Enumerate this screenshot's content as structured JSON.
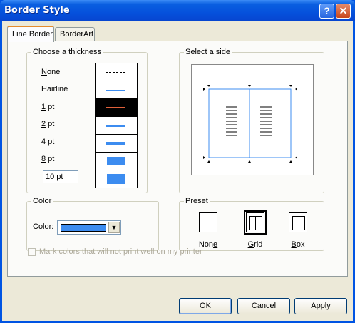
{
  "window": {
    "title": "Border Style",
    "help_glyph": "?",
    "close_glyph": "✕"
  },
  "tabs": [
    {
      "label": "Line Border",
      "active": true
    },
    {
      "label": "BorderArt",
      "active": false
    }
  ],
  "thickness": {
    "legend": "Choose a thickness",
    "options": [
      {
        "mnemonic": "N",
        "rest": "one"
      },
      {
        "mnemonic": "",
        "rest": "Hairline"
      },
      {
        "mnemonic": "1",
        "rest": " pt"
      },
      {
        "mnemonic": "2",
        "rest": " pt"
      },
      {
        "mnemonic": "4",
        "rest": " pt"
      },
      {
        "mnemonic": "8",
        "rest": " pt"
      }
    ],
    "custom_value": "10 pt",
    "selected_index": 2
  },
  "side": {
    "legend": "Select a side"
  },
  "color": {
    "legend": "Color",
    "label": "Color:",
    "value_hex": "#3c8cf0"
  },
  "preset": {
    "legend": "Preset",
    "items": [
      {
        "mnemonic": "e",
        "pre": "Non",
        "post": ""
      },
      {
        "mnemonic": "G",
        "pre": "",
        "post": "rid"
      },
      {
        "mnemonic": "B",
        "pre": "",
        "post": "ox"
      }
    ],
    "selected": "Grid"
  },
  "checkbox": {
    "label": "Mark colors that will not print well on my printer",
    "checked": false,
    "enabled": false
  },
  "buttons": {
    "ok": "OK",
    "cancel": "Cancel",
    "apply": "Apply"
  },
  "colors": {
    "accent": "#3c8cf0",
    "title_bar": "#0551dc",
    "dialog_bg": "#ece9d8"
  }
}
